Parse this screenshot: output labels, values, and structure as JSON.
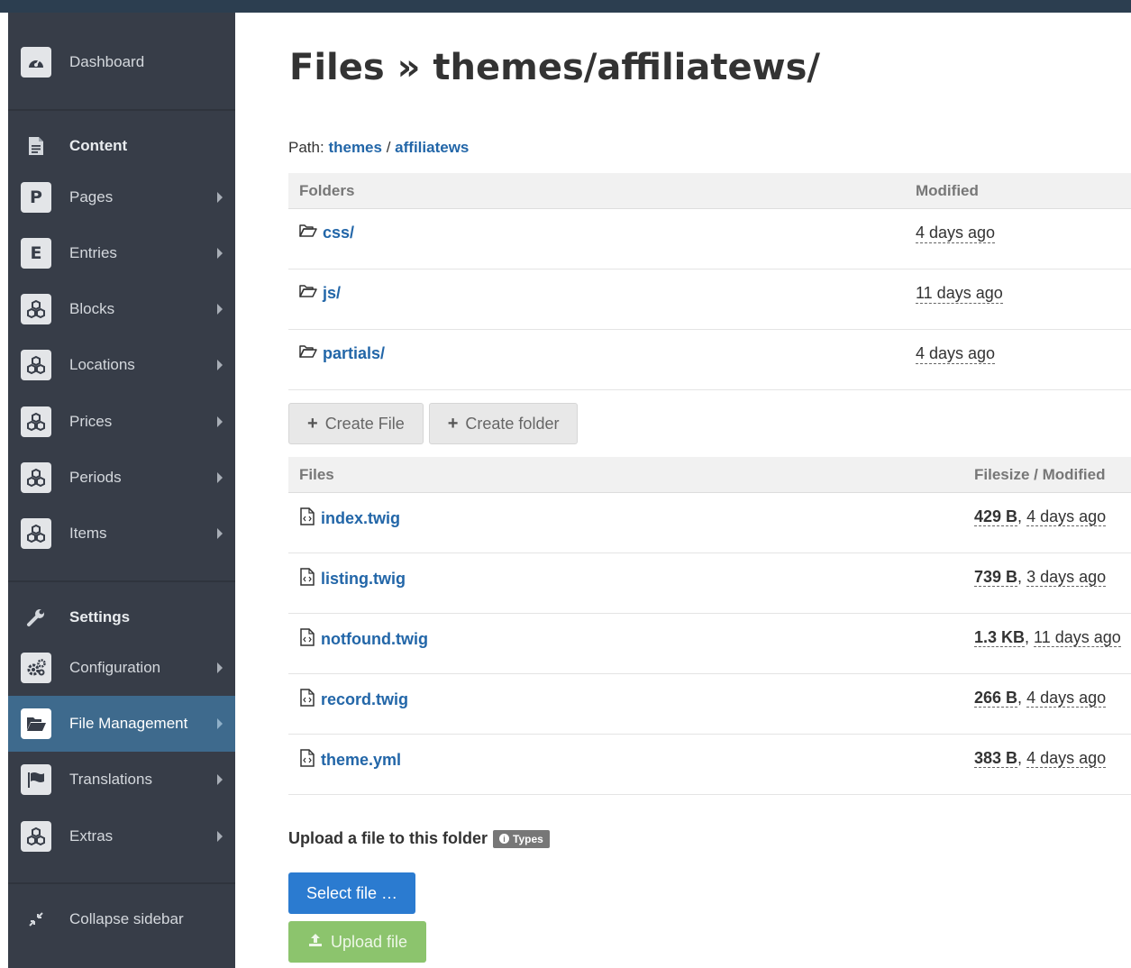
{
  "sidebar": {
    "dashboard": {
      "label": "Dashboard",
      "icon": "dashboard-icon"
    },
    "content_section": {
      "label": "Content",
      "icon": "document-icon"
    },
    "items": [
      {
        "label": "Pages",
        "icon": "letter-p-icon",
        "letter": "P"
      },
      {
        "label": "Entries",
        "icon": "letter-e-icon",
        "letter": "E"
      },
      {
        "label": "Blocks",
        "icon": "cubes-icon"
      },
      {
        "label": "Locations",
        "icon": "cubes-icon"
      },
      {
        "label": "Prices",
        "icon": "cubes-icon"
      },
      {
        "label": "Periods",
        "icon": "cubes-icon"
      },
      {
        "label": "Items",
        "icon": "cubes-icon"
      }
    ],
    "settings_section": {
      "label": "Settings",
      "icon": "wrench-icon"
    },
    "settings_items": [
      {
        "label": "Configuration",
        "icon": "gears-icon"
      },
      {
        "label": "File Management",
        "icon": "folder-open-icon",
        "active": true
      },
      {
        "label": "Translations",
        "icon": "flag-icon"
      },
      {
        "label": "Extras",
        "icon": "cubes-icon"
      }
    ],
    "collapse": {
      "label": "Collapse sidebar",
      "icon": "compress-icon"
    }
  },
  "main": {
    "title_bold": "Files",
    "title_sep": "»",
    "title_path": "themes/affiliatews/",
    "path_label": "Path:",
    "path_parts": [
      "themes",
      "affiliatews"
    ],
    "path_sep": "/",
    "folders_header": "Folders",
    "modified_header": "Modified",
    "folders": [
      {
        "name": "css/",
        "modified": "4 days ago"
      },
      {
        "name": "js/",
        "modified": "11 days ago"
      },
      {
        "name": "partials/",
        "modified": "4 days ago"
      }
    ],
    "create_file_label": "Create File",
    "create_folder_label": "Create folder",
    "files_header": "Files",
    "filesize_header": "Filesize / Modified",
    "files": [
      {
        "name": "index.twig",
        "size": "429 B",
        "modified": "4 days ago"
      },
      {
        "name": "listing.twig",
        "size": "739 B",
        "modified": "3 days ago"
      },
      {
        "name": "notfound.twig",
        "size": "1.3 KB",
        "modified": "11 days ago"
      },
      {
        "name": "record.twig",
        "size": "266 B",
        "modified": "4 days ago"
      },
      {
        "name": "theme.yml",
        "size": "383 B",
        "modified": "4 days ago"
      }
    ],
    "upload_label": "Upload a file to this folder",
    "types_badge": "Types",
    "select_file_label": "Select file …",
    "upload_file_label": "Upload file"
  },
  "colors": {
    "sidebar_bg": "#373d48",
    "active_bg": "#3e6a8d",
    "link": "#2266a8",
    "primary_button": "#2b7bd0",
    "success_button": "#8cc46d",
    "topbar": "#2c3e50"
  }
}
